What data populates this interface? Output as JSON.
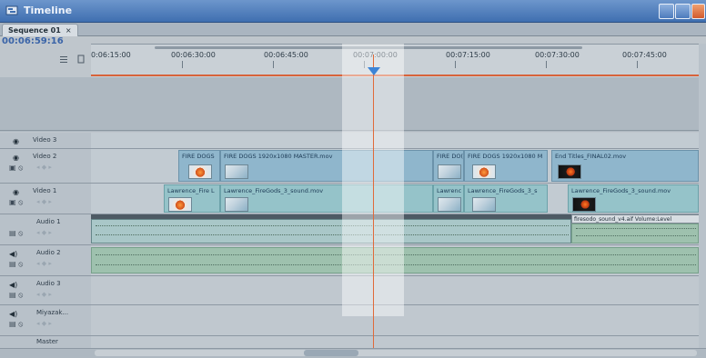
{
  "window": {
    "title": "Timeline"
  },
  "tab": {
    "label": "Sequence 01",
    "close": "×"
  },
  "timecode": "00:06:59:16",
  "ruler": {
    "ticks": [
      "0:06:15:00",
      "00:06:30:00",
      "00:06:45:00",
      "00:07:00:00",
      "00:07:15:00",
      "00:07:30:00",
      "00:07:45:00"
    ]
  },
  "tracks": {
    "video3": "Video 3",
    "video2": "Video 2",
    "video1": "Video 1",
    "audio1": "Audio 1",
    "audio2": "Audio 2",
    "audio3": "Audio 3",
    "audio4": "Miyazak...",
    "master": "Master"
  },
  "clips": {
    "v2_a": "FIRE DOGS",
    "v2_b": "FIRE DOGS 1920x1080 MASTER.mov",
    "v2_c": "FIRE DO(",
    "v2_d": "FIRE DOGS 1920x1080 M",
    "v2_e": "End Titles_FINAL02.mov",
    "v1_a": "Lawrence_Fire L",
    "v1_b": "Lawrence_FireGods_3_sound.mov",
    "v1_c": "Lawrenc",
    "v1_d": "Lawrence_FireGods_3_s",
    "v1_e": "Lawrence_FireGods_3_sound.mov",
    "a1_label": "firesodo_sound_v4.aif  Volume:Level"
  },
  "colors": {
    "title_gradient_top": "#6d96cc",
    "playhead": "#e06a3a",
    "playhead_marker": "#3d84d6"
  }
}
